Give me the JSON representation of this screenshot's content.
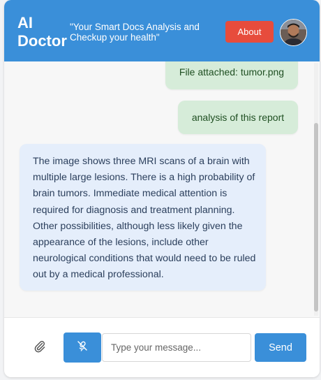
{
  "header": {
    "title_line1": "AI",
    "title_line2": "Doctor",
    "tagline": "\"Your Smart Docs Analysis and Checkup your health\"",
    "about_label": "About"
  },
  "messages": [
    {
      "role": "user",
      "text": "File attached: tumor.png"
    },
    {
      "role": "user",
      "text": "analysis of this report"
    },
    {
      "role": "assistant",
      "text": "The image shows three MRI scans of a brain with multiple large lesions. There is a high probability of brain tumors. Immediate medical attention is required for diagnosis and treatment planning. Other possibilities, although less likely given the appearance of the lesions, include other neurological conditions that would need to be ruled out by a medical professional."
    }
  ],
  "composer": {
    "placeholder": "Type your message...",
    "send_label": "Send",
    "attach_icon": "paperclip-icon",
    "mic_icon": "microphone-off-icon"
  },
  "colors": {
    "primary": "#3a8fd9",
    "about": "#e74c3c",
    "user_bubble": "#d6ecd9",
    "bot_bubble": "#e5eefb"
  }
}
